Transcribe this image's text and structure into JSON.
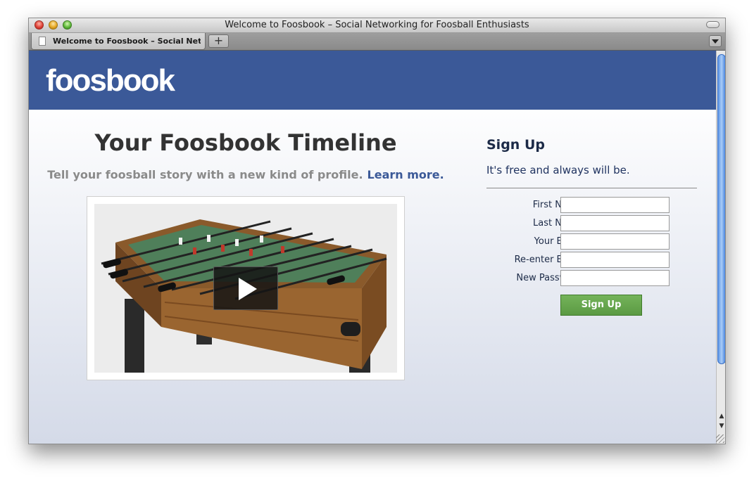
{
  "window": {
    "title": "Welcome to Foosbook – Social Networking for Foosball Enthusiasts",
    "tab_label": "Welcome to Foosbook – Social Net...",
    "new_tab_label": "+"
  },
  "header": {
    "logo": "foosbook"
  },
  "timeline": {
    "title": "Your Foosbook Timeline",
    "subtitle": "Tell your foosball story with a new kind of profile.",
    "learn_more": "Learn more."
  },
  "signup": {
    "title": "Sign Up",
    "subtitle": "It's free and always will be.",
    "fields": [
      {
        "label": "First Name:",
        "value": ""
      },
      {
        "label": "Last Name:",
        "value": ""
      },
      {
        "label": "Your Email:",
        "value": ""
      },
      {
        "label": "Re-enter Email:",
        "value": ""
      },
      {
        "label": "New Password:",
        "value": ""
      }
    ],
    "button": "Sign Up"
  },
  "colors": {
    "brand": "#3b5998",
    "signup_button": "#67a54b",
    "heading": "#333333"
  },
  "icons": {
    "play": "play-icon",
    "page": "page-icon"
  }
}
